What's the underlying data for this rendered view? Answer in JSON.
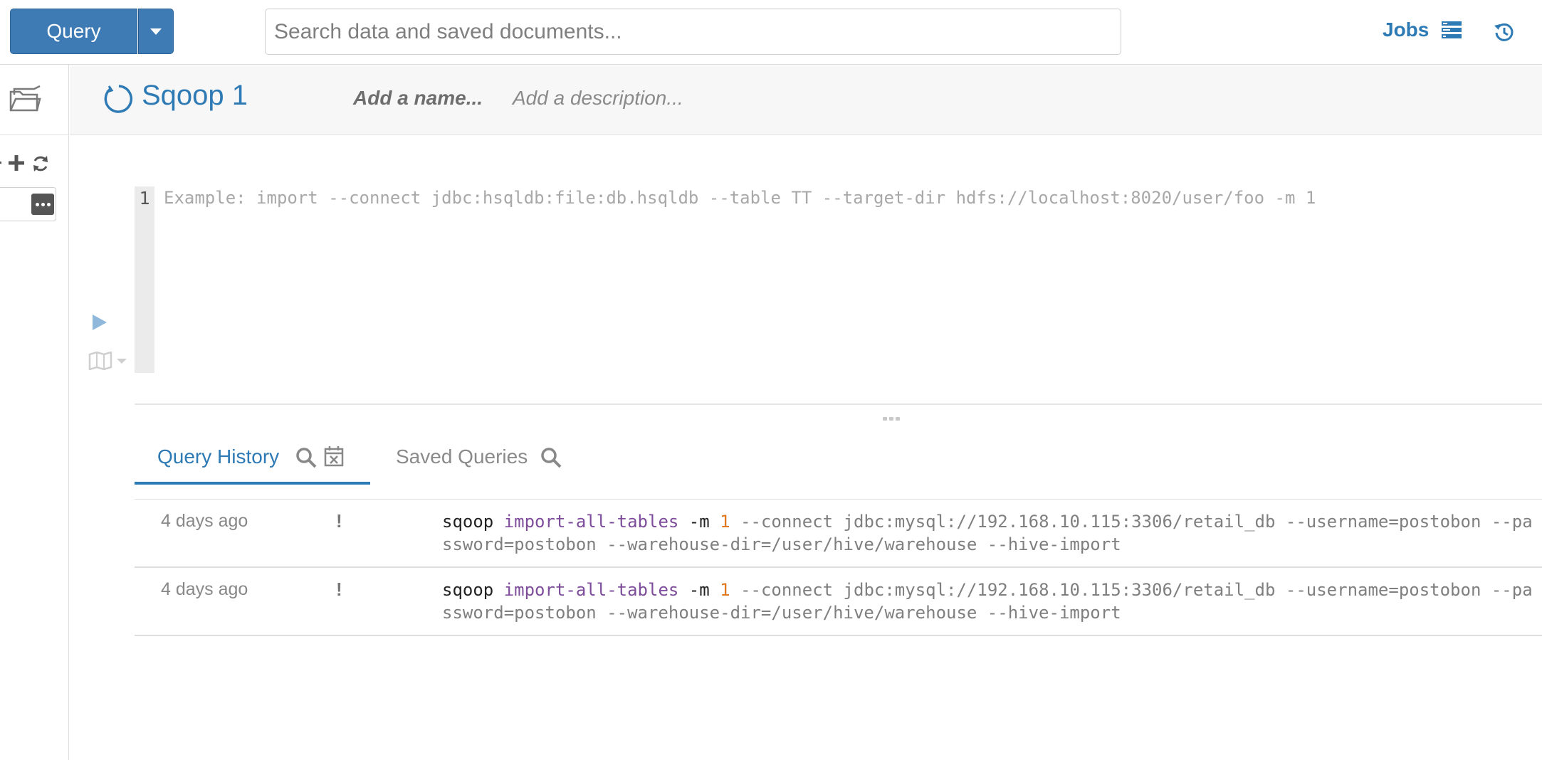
{
  "topbar": {
    "query_label": "Query",
    "search_placeholder": "Search data and saved documents...",
    "jobs_label": "Jobs"
  },
  "snippet": {
    "title": "Sqoop 1",
    "name_placeholder": "Add a name...",
    "description_placeholder": "Add a description..."
  },
  "editor": {
    "line_number": "1",
    "placeholder": "Example: import --connect jdbc:hsqldb:file:db.hsqldb --table TT --target-dir hdfs://localhost:8020/user/foo -m 1"
  },
  "tabs": {
    "history_label": "Query History",
    "saved_label": "Saved Queries"
  },
  "history": [
    {
      "time": "4 days ago",
      "flag": "!",
      "cmd": "sqoop",
      "subcommand": "import-all-tables",
      "opt": "-m",
      "num": "1",
      "rest": "--connect jdbc:mysql://192.168.10.115:3306/retail_db --username=postobon --password=postobon --warehouse-dir=/user/hive/warehouse --hive-import"
    },
    {
      "time": "4 days ago",
      "flag": "!",
      "cmd": "sqoop",
      "subcommand": "import-all-tables",
      "opt": "-m",
      "num": "1",
      "rest": "--connect jdbc:mysql://192.168.10.115:3306/retail_db --username=postobon --password=postobon --warehouse-dir=/user/hive/warehouse --hive-import"
    }
  ],
  "colors": {
    "primary": "#3e7bb4",
    "link": "#2d7ab4",
    "keyword": "#7d4d9b",
    "number": "#e07820"
  },
  "icons": [
    "caret-down-icon",
    "jobs-icon",
    "history-icon",
    "folder-icon",
    "plus-icon",
    "refresh-icon",
    "more-icon",
    "sqoop-icon",
    "play-icon",
    "book-icon",
    "search-icon",
    "calendar-clear-icon",
    "resize-handle-icon"
  ]
}
